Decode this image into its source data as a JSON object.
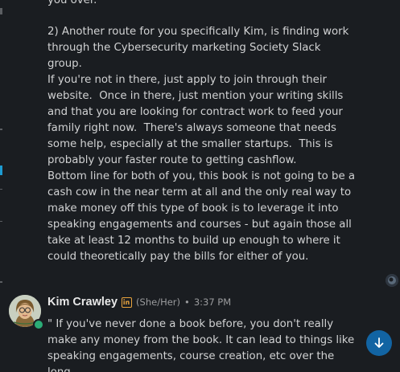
{
  "message_top": {
    "line_partial": "you over.",
    "paragraph_2": "2) Another route for you specifically Kim, is finding work\nthrough the Cybersecurity marketing Society Slack group.\nIf you're not in there, just apply to join through their\nwebsite.  Once in there, just mention your writing skills\nand that you are looking for contract work to feed your\nfamily right now.  There's always someone that needs\nsome help, especially at the smaller startups.  This is\nprobably your faster route to getting cashflow.",
    "paragraph_3": "Bottom line for both of you, this book is not going to be a\ncash cow in the near term at all and the only real way to\nmake money off this type of book is to leverage it into\nspeaking engagements and courses - but again those all\ntake at least 12 months to build up enough to where it\ncould theoretically pay the bills for either of you."
  },
  "reply": {
    "author": "Kim Crawley",
    "pronouns": "(She/Her)",
    "separator": "•",
    "timestamp": "3:37 PM",
    "text": "\" If you've never done a book before, you don't really\nmake any money from the book. It can lead to things like\nspeaking engagements, course creation, etc over the long"
  },
  "colors": {
    "background": "#1a1d21",
    "text": "#d1d2d3",
    "muted": "#9a9b9d",
    "online": "#2bac76",
    "accent": "#1264a3",
    "linkedin_badge": "#e8a33d"
  },
  "icons": {
    "linkedin": "linkedin-icon",
    "scroll_down": "arrow-down-icon",
    "presence": "online-status-icon"
  }
}
